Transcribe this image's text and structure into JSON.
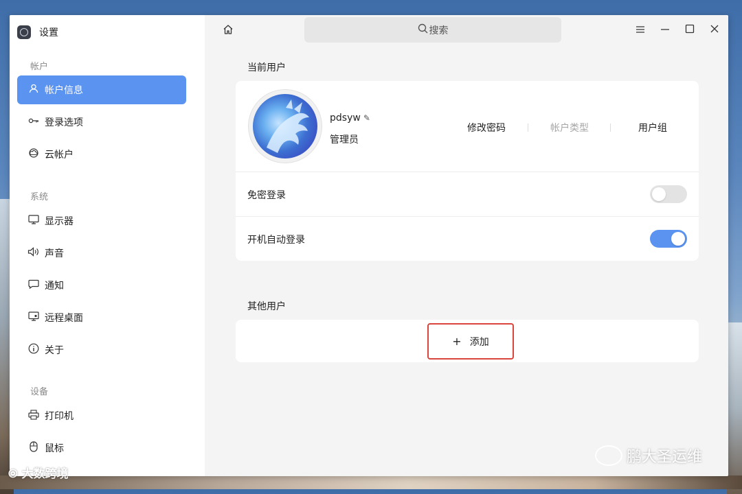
{
  "app": {
    "title": "设置"
  },
  "sidebar": {
    "groups": [
      {
        "label": "帐户",
        "items": [
          {
            "label": "帐户信息",
            "icon": "user-icon",
            "active": true
          },
          {
            "label": "登录选项",
            "icon": "key-icon"
          },
          {
            "label": "云帐户",
            "icon": "cloud-icon"
          }
        ]
      },
      {
        "label": "系统",
        "items": [
          {
            "label": "显示器",
            "icon": "monitor-icon"
          },
          {
            "label": "声音",
            "icon": "speaker-icon"
          },
          {
            "label": "通知",
            "icon": "chat-icon"
          },
          {
            "label": "远程桌面",
            "icon": "remote-desktop-icon"
          },
          {
            "label": "关于",
            "icon": "info-icon"
          }
        ]
      },
      {
        "label": "设备",
        "items": [
          {
            "label": "打印机",
            "icon": "printer-icon"
          },
          {
            "label": "鼠标",
            "icon": "mouse-icon"
          }
        ]
      }
    ]
  },
  "header": {
    "search_placeholder": "搜索"
  },
  "current_user": {
    "section_title": "当前用户",
    "username": "pdsyw",
    "role": "管理员",
    "actions": [
      {
        "label": "修改密码",
        "enabled": true
      },
      {
        "label": "帐户类型",
        "enabled": false
      },
      {
        "label": "用户组",
        "enabled": true
      }
    ],
    "settings": [
      {
        "label": "免密登录",
        "enabled": false
      },
      {
        "label": "开机自动登录",
        "enabled": true
      }
    ]
  },
  "other_users": {
    "section_title": "其他用户",
    "add_label": "添加"
  },
  "watermarks": {
    "left": "大数跨境",
    "right": "鹏大圣运维"
  },
  "colors": {
    "accent": "#5b93f0",
    "highlight_border": "#d9453b"
  }
}
